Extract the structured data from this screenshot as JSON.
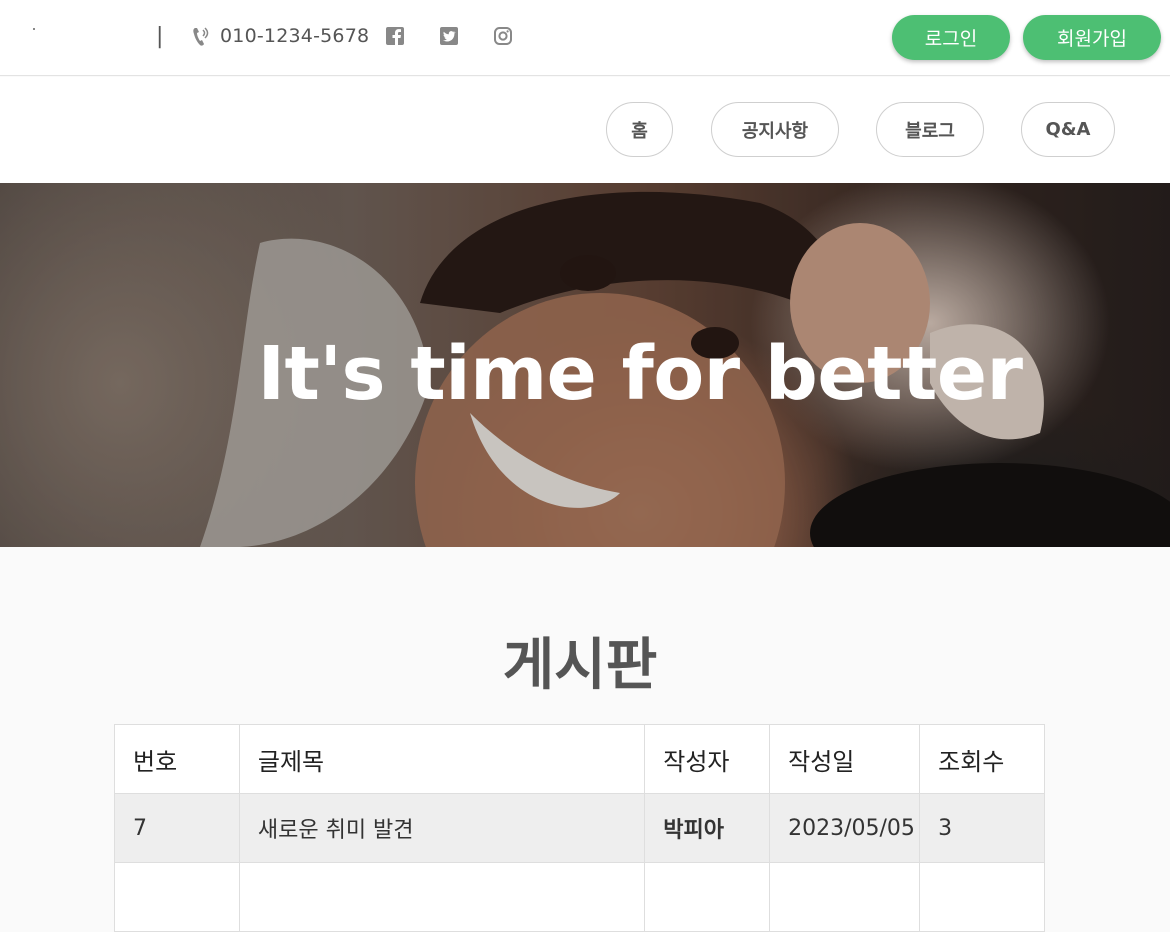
{
  "header": {
    "divider": "|",
    "phone": "010-1234-5678",
    "social_icons": [
      "facebook-icon",
      "twitter-icon",
      "instagram-icon"
    ],
    "login_label": "로그인",
    "signup_label": "회원가입",
    "accent_color": "#4dbf73"
  },
  "nav": {
    "items": [
      {
        "label": "홈"
      },
      {
        "label": "공지사항"
      },
      {
        "label": "블로그"
      },
      {
        "label": "Q&A"
      }
    ]
  },
  "hero": {
    "title": "It's time for better"
  },
  "board": {
    "title": "게시판",
    "columns": [
      "번호",
      "글제목",
      "작성자",
      "작성일",
      "조회수"
    ],
    "rows": [
      {
        "num": "7",
        "title": "새로운 취미 발견",
        "author": "박피아",
        "date": "2023/05/05",
        "views": "3"
      }
    ]
  }
}
